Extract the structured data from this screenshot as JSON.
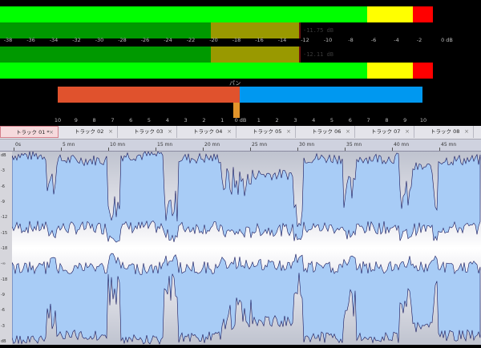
{
  "meters": {
    "scale": [
      "-38",
      "-36",
      "-34",
      "-32",
      "-30",
      "-28",
      "-26",
      "-24",
      "-22",
      "-20",
      "-18",
      "-16",
      "-14",
      "-12",
      "-10",
      "-8",
      "-6",
      "-4",
      "-2",
      "0 dB"
    ],
    "rms_left_readout": "-11.75 dB",
    "rms_right_readout": "-12.11 dB",
    "colors": {
      "green": "#00ff00",
      "dark_green": "#009900",
      "olive": "#999900",
      "yellow": "#ffff00",
      "red": "#ff0000"
    }
  },
  "pan": {
    "label": "パン",
    "scale": [
      "10",
      "9",
      "8",
      "7",
      "6",
      "5",
      "4",
      "3",
      "2",
      "1",
      "0 dB",
      "1",
      "2",
      "3",
      "4",
      "5",
      "6",
      "7",
      "8",
      "9",
      "10"
    ],
    "left_color": "#e0522d",
    "right_color": "#0098f0",
    "knob_color": "#e2942a"
  },
  "tabs": [
    {
      "label": "トラック 01 *",
      "active": true
    },
    {
      "label": "トラック 02",
      "active": false
    },
    {
      "label": "トラック 03",
      "active": false
    },
    {
      "label": "トラック 04",
      "active": false
    },
    {
      "label": "トラック 05",
      "active": false
    },
    {
      "label": "トラック 06",
      "active": false
    },
    {
      "label": "トラック 07",
      "active": false
    },
    {
      "label": "トラック 08",
      "active": false
    }
  ],
  "tab_close": "×",
  "ruler": [
    "0s",
    "5 mn",
    "10 mn",
    "15 mn",
    "20 mn",
    "25 mn",
    "30 mn",
    "35 mn",
    "40 mn",
    "45 mn"
  ],
  "db_gutter_top": [
    "dB",
    "-3",
    "-6",
    "-9",
    "-12",
    "-15",
    "-18",
    "-∞",
    "-18",
    "-9",
    "-6",
    "-3",
    "dB"
  ],
  "waveform": {
    "fill": "#a8ccf6",
    "stroke": "#14145a",
    "background": "#d6d6de",
    "center_band": "#ffffff"
  }
}
